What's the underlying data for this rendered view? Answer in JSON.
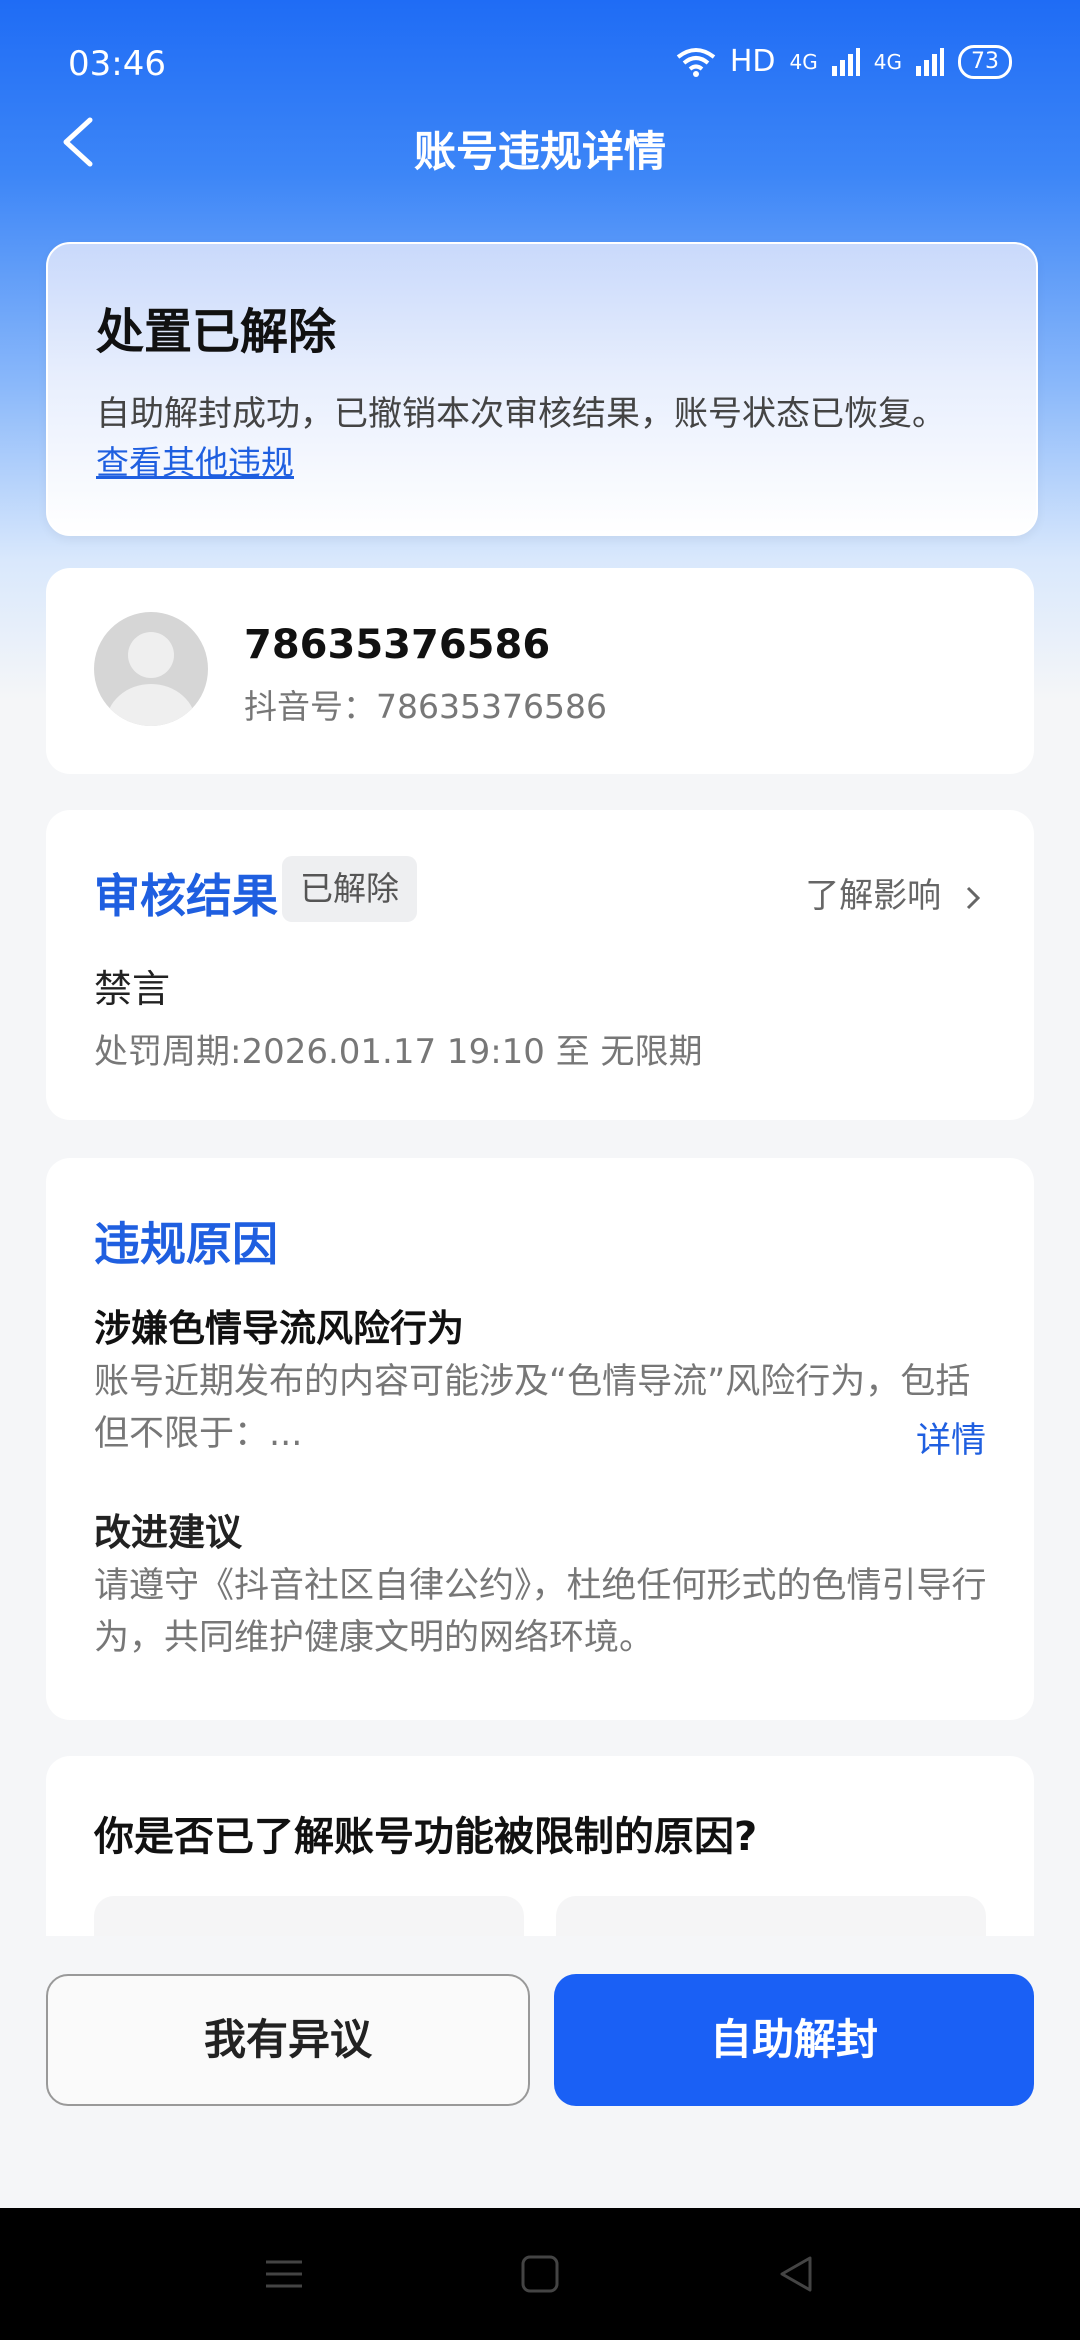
{
  "status_bar": {
    "time": "03:46",
    "network": "HD",
    "signal1": "4G",
    "signal2": "4G",
    "battery": "73"
  },
  "nav": {
    "title": "账号违规详情"
  },
  "status_card": {
    "title": "处置已解除",
    "description": "自助解封成功，已撤销本次审核结果，账号状态已恢复。",
    "link": "查看其他违规"
  },
  "account": {
    "name": "78635376586",
    "douyin_id": "抖音号：78635376586"
  },
  "review": {
    "title": "审核结果",
    "badge": "已解除",
    "learn_more": "了解影响",
    "item": "禁言",
    "period": "处罚周期:2026.01.17 19:10 至 无限期"
  },
  "reason": {
    "title": "违规原因",
    "subtitle": "涉嫌色情导流风险行为",
    "text": "账号近期发布的内容可能涉及“色情导流”风险行为，包括但不限于：...",
    "detail_link": "详情",
    "advice_title": "改进建议",
    "advice_text": "请遵守《抖音社区自律公约》，杜绝任何形式的色情引导行为，共同维护健康文明的网络环境。"
  },
  "question": {
    "text": "你是否已了解账号功能被限制的原因?"
  },
  "actions": {
    "objection": "我有异议",
    "self_unban": "自助解封"
  },
  "colors": {
    "accent": "#1a60f5",
    "link": "#1f5fe0"
  }
}
